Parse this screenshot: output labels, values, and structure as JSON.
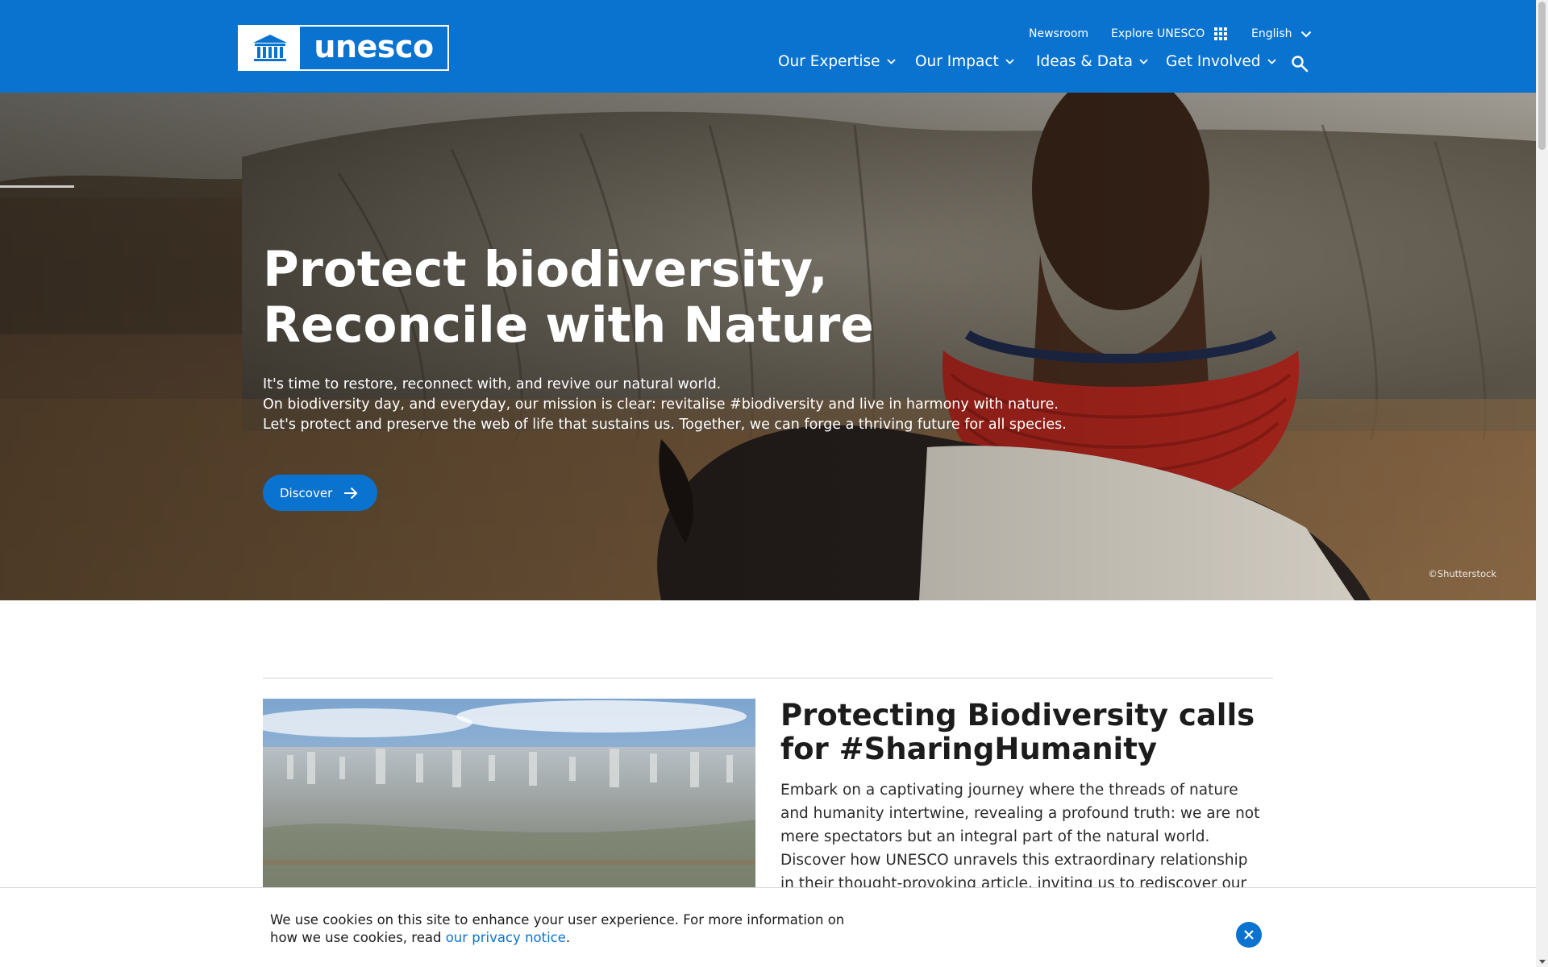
{
  "header": {
    "logo_text": "unesco",
    "utility": {
      "newsroom": "Newsroom",
      "explore": "Explore UNESCO",
      "language": "English"
    },
    "nav": [
      {
        "label": "Our Expertise"
      },
      {
        "label": "Our Impact"
      },
      {
        "label": "Ideas & Data"
      },
      {
        "label": "Get Involved"
      }
    ],
    "search_icon": "search-icon",
    "brand_color": "#0a73d0"
  },
  "hero": {
    "title_line1": "Protect biodiversity,",
    "title_line2": "Reconcile with Nature",
    "desc_lines": [
      "It's time to restore, reconnect with, and revive our natural world.",
      "On biodiversity day, and everyday, our mission is clear: revitalise #biodiversity and live in harmony with nature.",
      "Let's protect and preserve the web of life that sustains us. Together, we can forge a thriving future for all species."
    ],
    "button_label": "Discover",
    "credit": "©Shutterstock"
  },
  "article": {
    "title": "Protecting Biodiversity calls for #SharingHumanity",
    "body": "Embark on a captivating journey where the threads of nature and humanity intertwine, revealing a profound truth: we are not mere spectators but an integral part of the natural world. Discover how UNESCO unravels this extraordinary relationship in their thought-provoking article, inviting us to rediscover our roots and redefine our"
  },
  "cookie": {
    "text": "We use cookies on this site to enhance your user experience. For more information on how we use cookies, read ",
    "link_text": "our privacy notice",
    "suffix": "."
  }
}
